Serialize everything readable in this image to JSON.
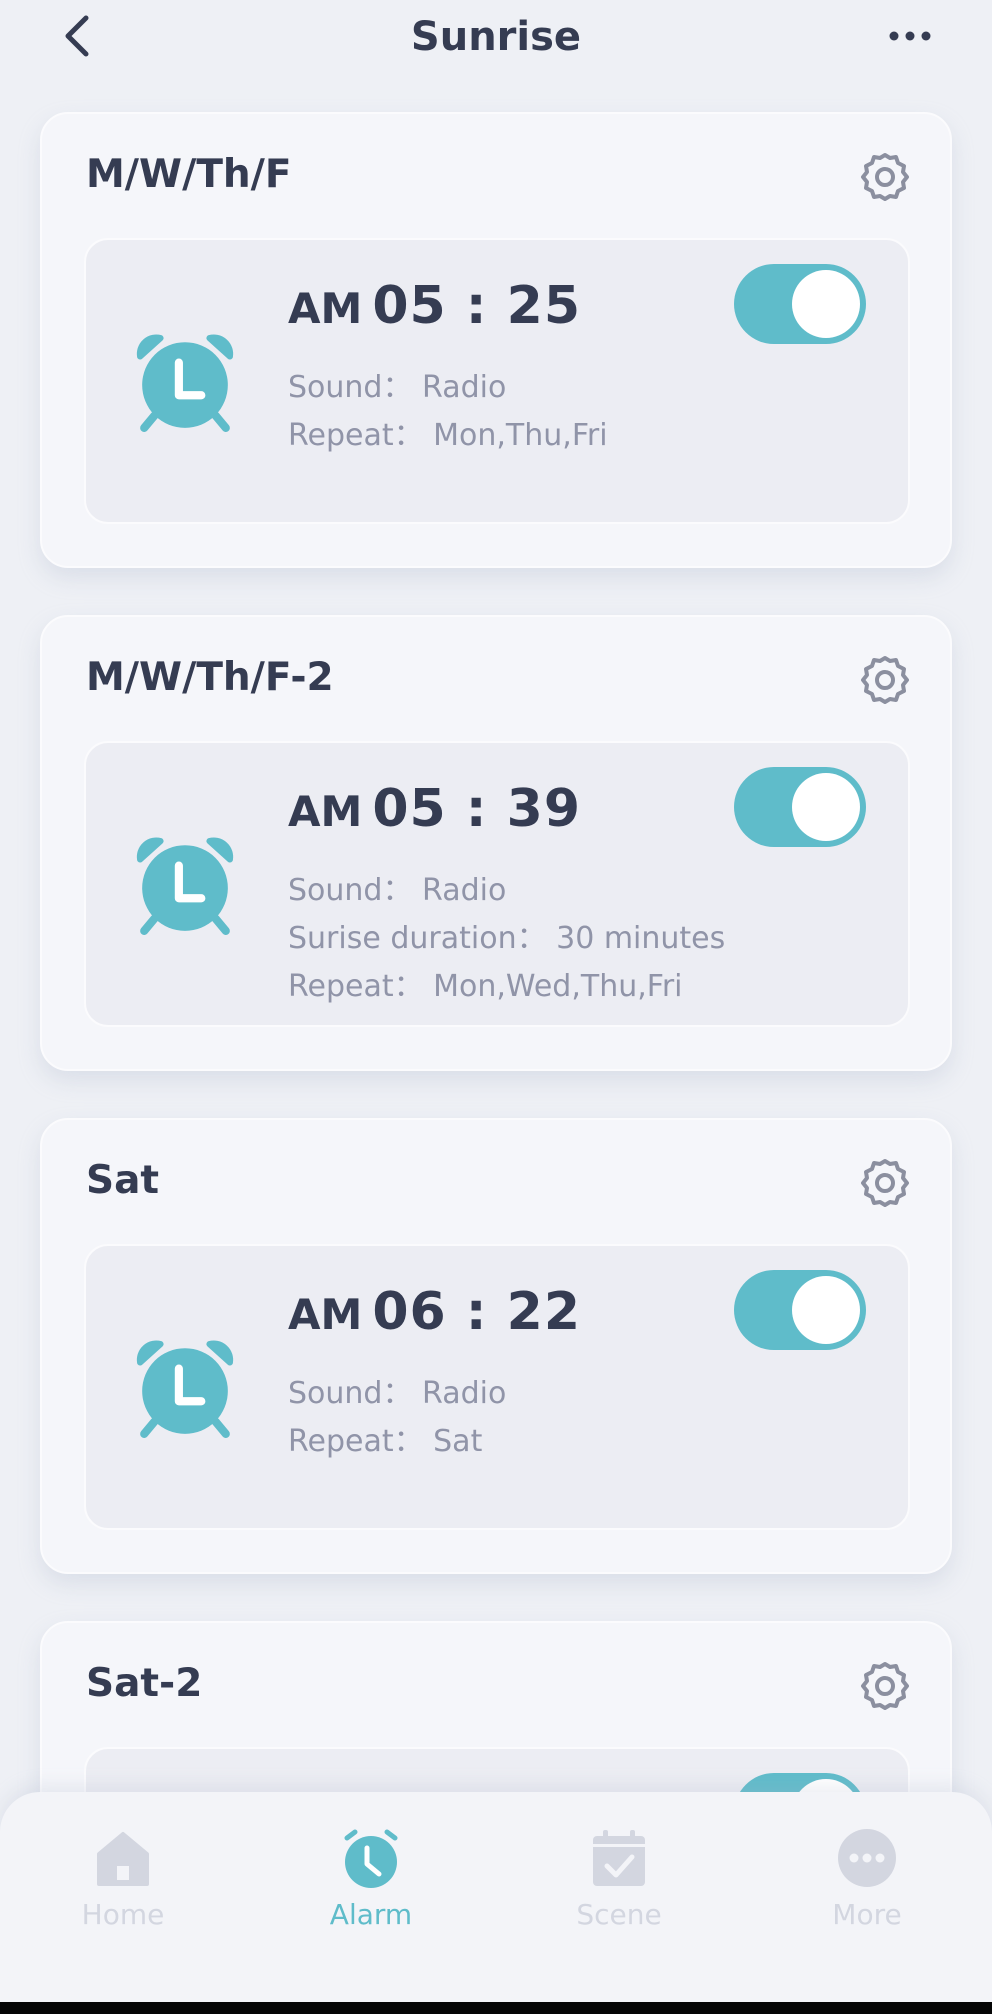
{
  "header": {
    "title": "Sunrise"
  },
  "colors": {
    "accent": "#5fbcca",
    "text_primary": "#353c52",
    "text_secondary": "#9094a8",
    "tab_inactive": "#d3d6e0",
    "background": "#eef0f5"
  },
  "alarms": [
    {
      "name": "M/W/Th/F",
      "ampm": "AM",
      "time": "05 : 25",
      "enabled": true,
      "details": [
        "Sound： Radio",
        "Repeat： Mon,Thu,Fri"
      ]
    },
    {
      "name": "M/W/Th/F-2",
      "ampm": "AM",
      "time": "05 : 39",
      "enabled": true,
      "details": [
        "Sound： Radio",
        "Surise duration： 30 minutes",
        "Repeat： Mon,Wed,Thu,Fri"
      ]
    },
    {
      "name": "Sat",
      "ampm": "AM",
      "time": "06 : 22",
      "enabled": true,
      "details": [
        "Sound： Radio",
        "Repeat： Sat"
      ]
    },
    {
      "name": "Sat-2",
      "enabled": true
    }
  ],
  "tabbar": {
    "items": [
      {
        "label": "Home",
        "icon": "home-icon",
        "active": false
      },
      {
        "label": "Alarm",
        "icon": "alarm-icon",
        "active": true
      },
      {
        "label": "Scene",
        "icon": "calendar-check-icon",
        "active": false
      },
      {
        "label": "More",
        "icon": "more-dots-icon",
        "active": false
      }
    ]
  }
}
